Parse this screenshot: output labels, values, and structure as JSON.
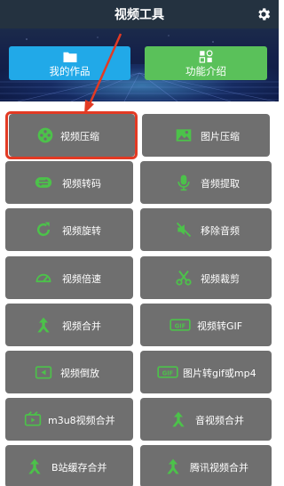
{
  "header": {
    "title": "视频工具",
    "settings_icon": "gear-icon"
  },
  "top_buttons": {
    "works": {
      "label": "我的作品",
      "icon": "folder-icon",
      "color": "#21a9e8"
    },
    "intro": {
      "label": "功能介绍",
      "icon": "apps-grid-icon",
      "color": "#5ac15a"
    }
  },
  "tools": [
    {
      "label": "视频压缩",
      "icon": "film-reel-icon"
    },
    {
      "label": "图片压缩",
      "icon": "image-icon"
    },
    {
      "label": "视频转码",
      "icon": "convert-icon"
    },
    {
      "label": "音频提取",
      "icon": "microphone-icon"
    },
    {
      "label": "视频旋转",
      "icon": "rotate-icon"
    },
    {
      "label": "移除音频",
      "icon": "mute-icon"
    },
    {
      "label": "视频倍速",
      "icon": "speedometer-icon"
    },
    {
      "label": "视频裁剪",
      "icon": "scissors-icon"
    },
    {
      "label": "视频合并",
      "icon": "merge-icon"
    },
    {
      "label": "视频转GIF",
      "icon": "gif-icon"
    },
    {
      "label": "视频倒放",
      "icon": "reverse-icon"
    },
    {
      "label": "图片转gif或mp4",
      "icon": "gif-icon"
    },
    {
      "label": "m3u8视频合并",
      "icon": "video-file-icon"
    },
    {
      "label": "音视频合并",
      "icon": "merge-icon"
    },
    {
      "label": "B站缓存合并",
      "icon": "merge-icon"
    },
    {
      "label": "腾讯视频合并",
      "icon": "merge-icon"
    }
  ],
  "colors": {
    "tile": "#6f6f6f",
    "highlight": "#e23a24",
    "icon_green": "#4cc24a"
  }
}
